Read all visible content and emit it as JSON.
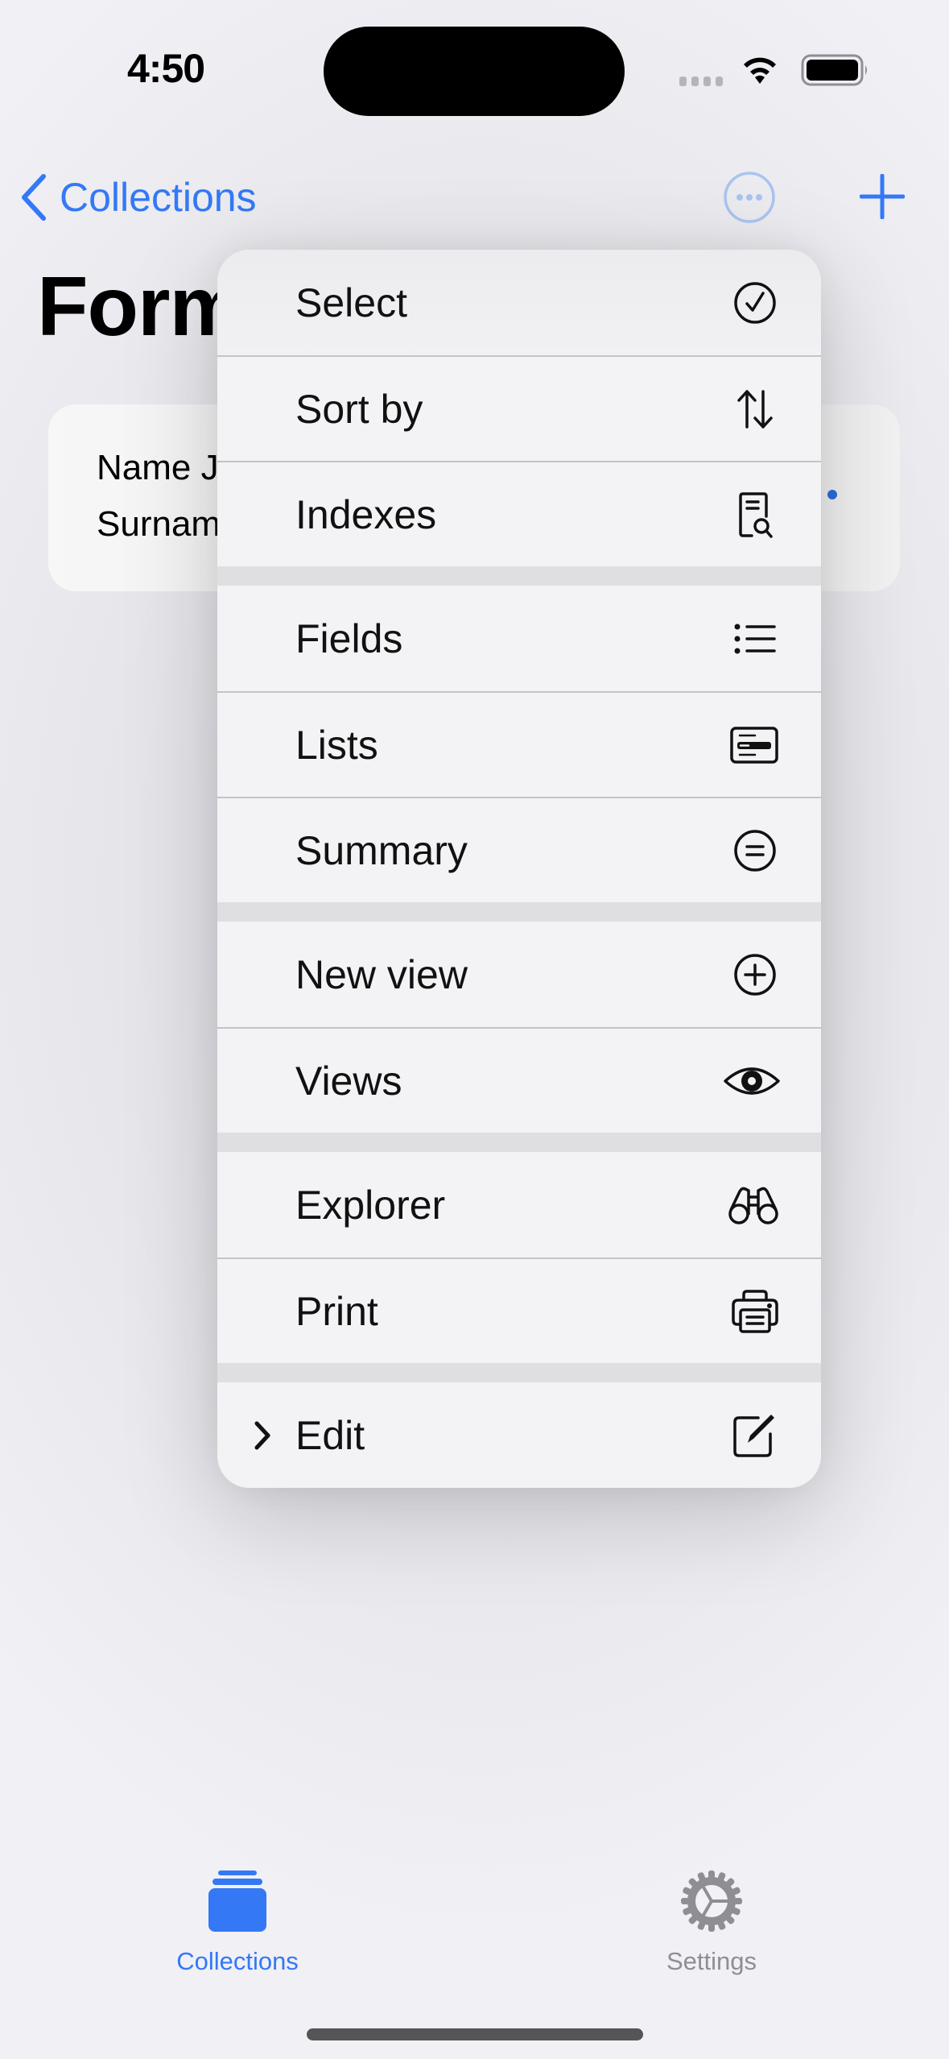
{
  "status_bar": {
    "time": "4:50",
    "icons": [
      "cellular-signal-icon",
      "wifi-icon",
      "battery-icon"
    ]
  },
  "nav": {
    "back_label": "Collections",
    "more_icon": "ellipsis-circle-icon",
    "add_icon": "plus-icon"
  },
  "page": {
    "title": "Form"
  },
  "card": {
    "line1": "Name J",
    "line2": "Surnam",
    "more_icon": "ellipsis-icon"
  },
  "menu": {
    "sections": [
      [
        {
          "label": "Select",
          "icon": "checkmark-circle-icon"
        },
        {
          "label": "Sort by",
          "icon": "arrow-up-arrow-down-icon"
        },
        {
          "label": "Indexes",
          "icon": "doc-magnifyingglass-icon"
        }
      ],
      [
        {
          "label": "Fields",
          "icon": "list-bullet-icon"
        },
        {
          "label": "Lists",
          "icon": "list-card-icon"
        },
        {
          "label": "Summary",
          "icon": "equal-circle-icon"
        }
      ],
      [
        {
          "label": "New view",
          "icon": "plus-circle-icon"
        },
        {
          "label": "Views",
          "icon": "eye-icon"
        }
      ],
      [
        {
          "label": "Explorer",
          "icon": "binoculars-icon"
        },
        {
          "label": "Print",
          "icon": "printer-icon"
        }
      ],
      [
        {
          "label": "Edit",
          "icon": "square-and-pencil-icon",
          "submenu": true
        }
      ]
    ]
  },
  "tab_bar": {
    "tabs": [
      {
        "label": "Collections",
        "icon": "collections-stack-icon",
        "selected": true
      },
      {
        "label": "Settings",
        "icon": "gear-icon",
        "selected": false
      }
    ]
  },
  "colors": {
    "accent": "#3478f6",
    "inactive_tab": "#8e8e93",
    "menu_background": "#f3f3f5",
    "menu_section_gap": "#dfdfe1"
  }
}
